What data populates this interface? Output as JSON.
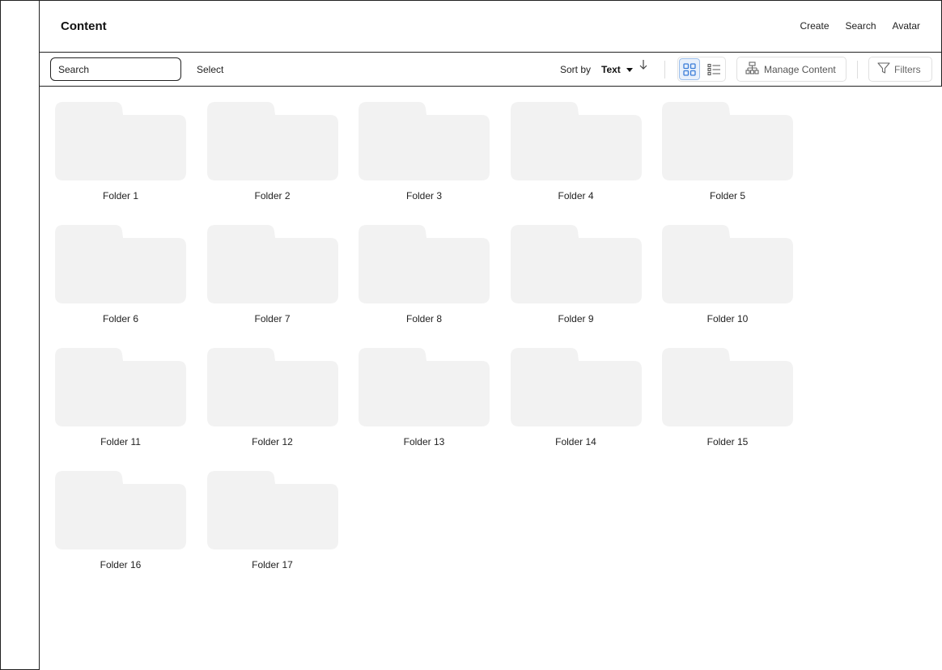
{
  "header": {
    "title": "Content",
    "nav": [
      "Create",
      "Search",
      "Avatar"
    ]
  },
  "toolbar": {
    "search_placeholder": "Search",
    "select_label": "Select",
    "sort_label": "Sort by",
    "sort_value": "Text",
    "manage_label": "Manage Content",
    "filters_label": "Filters",
    "active_view": "grid"
  },
  "colors": {
    "folder_fill": "#f2f2f2",
    "active_view_bg": "#e8f0fb",
    "active_view_icon": "#3b7dd8"
  },
  "folders": [
    "Folder 1",
    "Folder 2",
    "Folder 3",
    "Folder 4",
    "Folder 5",
    "Folder 6",
    "Folder 7",
    "Folder 8",
    "Folder 9",
    "Folder 10",
    "Folder 11",
    "Folder 12",
    "Folder 13",
    "Folder 14",
    "Folder 15",
    "Folder 16",
    "Folder 17"
  ]
}
